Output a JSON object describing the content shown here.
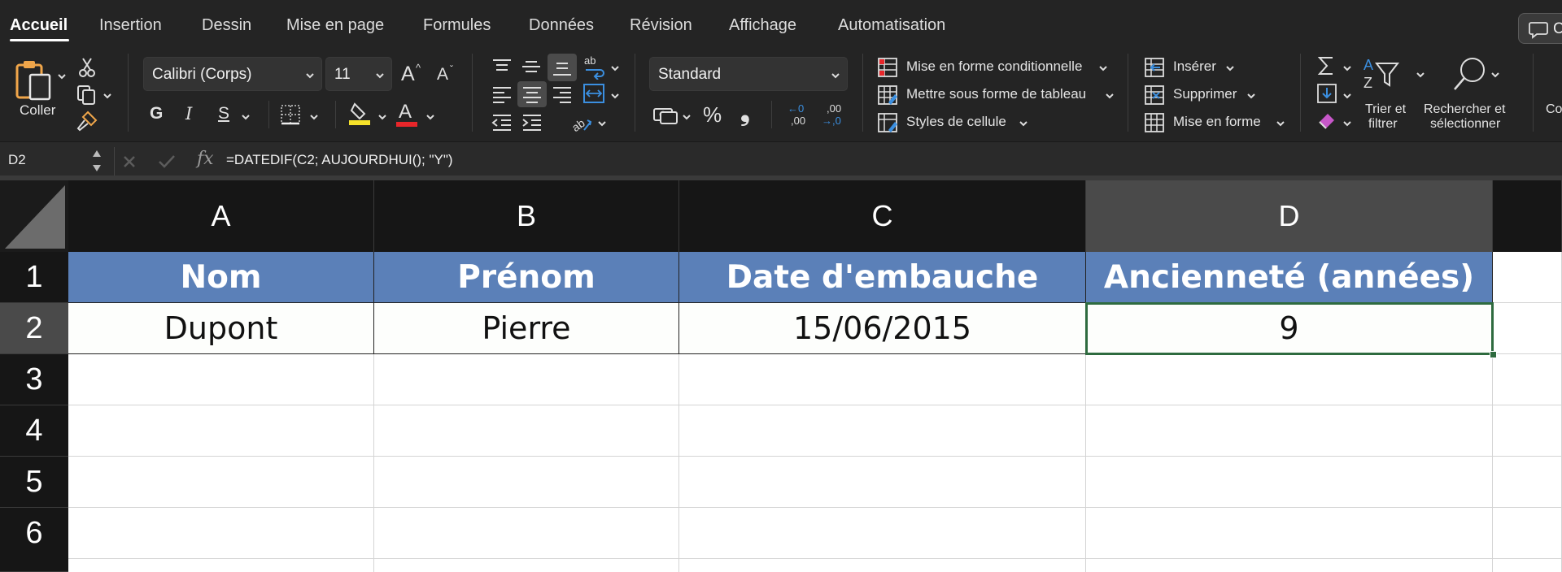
{
  "tabs": [
    {
      "label": "Accueil",
      "active": true
    },
    {
      "label": "Insertion"
    },
    {
      "label": "Dessin"
    },
    {
      "label": "Mise en page"
    },
    {
      "label": "Formules"
    },
    {
      "label": "Données"
    },
    {
      "label": "Révision"
    },
    {
      "label": "Affichage"
    },
    {
      "label": "Automatisation"
    }
  ],
  "comment_button": {
    "label": "C",
    "icon": "comment-icon"
  },
  "ribbon": {
    "clipboard": {
      "paste_label": "Coller"
    },
    "font": {
      "family": "Calibri (Corps)",
      "size": "11",
      "grow": "A",
      "shrink": "A",
      "bold": "G",
      "italic": "I",
      "underline": "S",
      "font_color_letter": "A",
      "highlight_color": "#f5e12a",
      "font_color": "#e8262a"
    },
    "number": {
      "format": "Standard",
      "percent": "%",
      "comma": "❟",
      "inc_decimal_top": "←0",
      "inc_decimal_bottom": ",00",
      "dec_decimal_top": ",00",
      "dec_decimal_bottom": "→,0"
    },
    "styles": {
      "conditional": "Mise en forme conditionnelle",
      "as_table": "Mettre sous forme de tableau",
      "cell_styles": "Styles de cellule"
    },
    "cells": {
      "insert": "Insérer",
      "delete": "Supprimer",
      "format": "Mise en forme"
    },
    "editing": {
      "sort_line1": "Trier et",
      "sort_line2": "filtrer",
      "find_line1": "Rechercher et",
      "find_line2": "sélectionner",
      "more": "Co"
    }
  },
  "formula_bar": {
    "name_box": "D2",
    "fx": "fx",
    "formula": "=DATEDIF(C2; AUJOURDHUI(); \"Y\")"
  },
  "sheet": {
    "columns": [
      "A",
      "B",
      "C",
      "D"
    ],
    "rows": [
      "1",
      "2",
      "3",
      "4",
      "5",
      "6"
    ],
    "selected_cell": "D2",
    "header_row": [
      "Nom",
      "Prénom",
      "Date d'embauche",
      "Ancienneté (années)"
    ],
    "data_row": [
      "Dupont",
      "Pierre",
      "15/06/2015",
      "9"
    ],
    "header_fill": "#5b80b8",
    "selection_color": "#2e6b3f"
  }
}
